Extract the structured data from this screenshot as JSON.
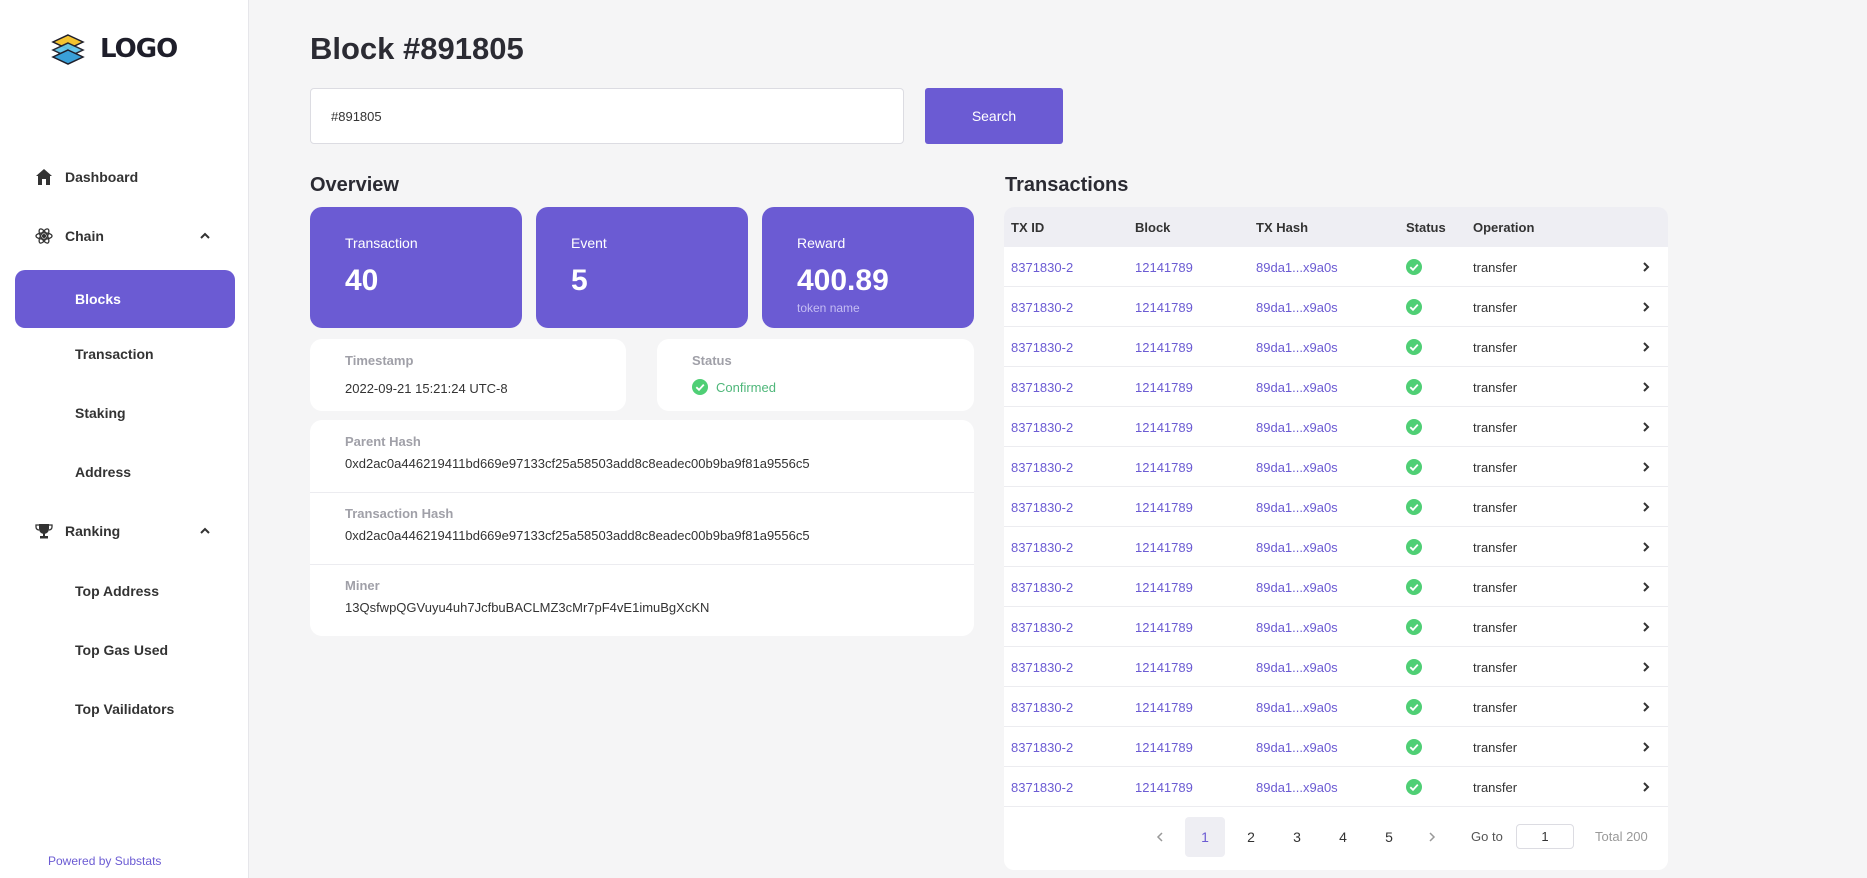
{
  "logo": {
    "text": "LOGO"
  },
  "sidebar": {
    "dashboard": "Dashboard",
    "chain": "Chain",
    "chain_items": [
      "Blocks",
      "Transaction",
      "Staking",
      "Address"
    ],
    "ranking": "Ranking",
    "ranking_items": [
      "Top Address",
      "Top Gas Used",
      "Top Vailidators"
    ],
    "footer": "Powered by Substats"
  },
  "page": {
    "title": "Block #891805",
    "search_value": "#891805",
    "search_button": "Search"
  },
  "overview": {
    "title": "Overview",
    "transaction_label": "Transaction",
    "transaction_value": "40",
    "event_label": "Event",
    "event_value": "5",
    "reward_label": "Reward",
    "reward_value": "400.89",
    "reward_unit": "token name",
    "timestamp_label": "Timestamp",
    "timestamp_value": "2022-09-21 15:21:24 UTC-8",
    "status_label": "Status",
    "status_value": "Confirmed",
    "parent_hash_label": "Parent Hash",
    "parent_hash_value": "0xd2ac0a446219411bd669e97133cf25a58503add8c8eadec00b9ba9f81a9556c5",
    "tx_hash_label": "Transaction Hash",
    "tx_hash_value": "0xd2ac0a446219411bd669e97133cf25a58503add8c8eadec00b9ba9f81a9556c5",
    "miner_label": "Miner",
    "miner_value": "13QsfwpQGVuyu4uh7JcfbuBACLMZ3cMr7pF4vE1imuBgXcKN"
  },
  "transactions": {
    "title": "Transactions",
    "columns": [
      "TX ID",
      "Block",
      "TX Hash",
      "Status",
      "Operation"
    ],
    "rows": [
      {
        "tx_id": "8371830-2",
        "block": "12141789",
        "hash": "89da1...x9a0s",
        "operation": "transfer"
      },
      {
        "tx_id": "8371830-2",
        "block": "12141789",
        "hash": "89da1...x9a0s",
        "operation": "transfer"
      },
      {
        "tx_id": "8371830-2",
        "block": "12141789",
        "hash": "89da1...x9a0s",
        "operation": "transfer"
      },
      {
        "tx_id": "8371830-2",
        "block": "12141789",
        "hash": "89da1...x9a0s",
        "operation": "transfer"
      },
      {
        "tx_id": "8371830-2",
        "block": "12141789",
        "hash": "89da1...x9a0s",
        "operation": "transfer"
      },
      {
        "tx_id": "8371830-2",
        "block": "12141789",
        "hash": "89da1...x9a0s",
        "operation": "transfer"
      },
      {
        "tx_id": "8371830-2",
        "block": "12141789",
        "hash": "89da1...x9a0s",
        "operation": "transfer"
      },
      {
        "tx_id": "8371830-2",
        "block": "12141789",
        "hash": "89da1...x9a0s",
        "operation": "transfer"
      },
      {
        "tx_id": "8371830-2",
        "block": "12141789",
        "hash": "89da1...x9a0s",
        "operation": "transfer"
      },
      {
        "tx_id": "8371830-2",
        "block": "12141789",
        "hash": "89da1...x9a0s",
        "operation": "transfer"
      },
      {
        "tx_id": "8371830-2",
        "block": "12141789",
        "hash": "89da1...x9a0s",
        "operation": "transfer"
      },
      {
        "tx_id": "8371830-2",
        "block": "12141789",
        "hash": "89da1...x9a0s",
        "operation": "transfer"
      },
      {
        "tx_id": "8371830-2",
        "block": "12141789",
        "hash": "89da1...x9a0s",
        "operation": "transfer"
      },
      {
        "tx_id": "8371830-2",
        "block": "12141789",
        "hash": "89da1...x9a0s",
        "operation": "transfer"
      }
    ],
    "pages": [
      "1",
      "2",
      "3",
      "4",
      "5"
    ],
    "current_page": "1",
    "goto_label": "Go to",
    "goto_value": "1",
    "total": "Total 200"
  },
  "colors": {
    "accent": "#6b5bd3",
    "success": "#4fcf75"
  },
  "icons": [
    "home-icon",
    "atom-icon",
    "trophy-icon",
    "chevron-up-icon",
    "chevron-right-icon",
    "check-circle-icon"
  ]
}
